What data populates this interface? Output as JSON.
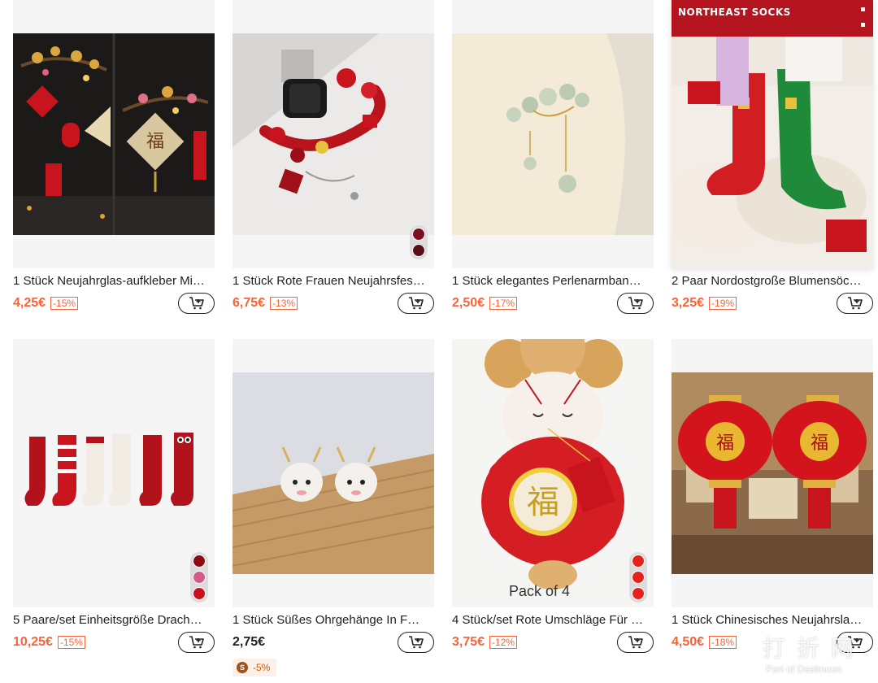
{
  "products": [
    {
      "title": "1 Stück Neujahrglas-aufkleber Mi…",
      "price": "4,25€",
      "discount": "-15%"
    },
    {
      "title": "1 Stück Rote Frauen Neujahrsfes…",
      "price": "6,75€",
      "discount": "-13%",
      "swatches": [
        "#7a1020",
        "#5a0f14"
      ]
    },
    {
      "title": "1 Stück elegantes Perlenarmban…",
      "price": "2,50€",
      "discount": "-17%"
    },
    {
      "title": "2 Paar Nordostgroße Blumensöc…",
      "price": "3,25€",
      "discount": "-19%",
      "banner": "NORTHEAST SOCKS"
    },
    {
      "title": "5 Paare/set Einheitsgröße Drach…",
      "price": "10,25€",
      "discount": "-15%",
      "swatches": [
        "#8c0a14",
        "#d45a8a",
        "#c8101e"
      ]
    },
    {
      "title": "1 Stück Süßes Ohrgehänge In F…",
      "price": "2,75€",
      "coupon": "-5%",
      "coupon_icon": "S"
    },
    {
      "title": "4 Stück/set Rote Umschläge Für …",
      "price": "3,75€",
      "discount": "-12%",
      "image_text": "Pack of 4",
      "swatches": [
        "#e5231b",
        "#e5231b",
        "#e5231b"
      ]
    },
    {
      "title": "1 Stück Chinesisches Neujahrsla…",
      "price": "4,50€",
      "discount": "-18%"
    }
  ],
  "watermark": {
    "cn": "打折网",
    "en": "Part of Dealmoon"
  },
  "colors": {
    "price": "#fa6338",
    "coupon_bg": "#fdf0e8",
    "banner": "#b3141d"
  },
  "icons": {
    "cart": "add-to-cart-icon",
    "coupon": "coupon-s-icon"
  }
}
